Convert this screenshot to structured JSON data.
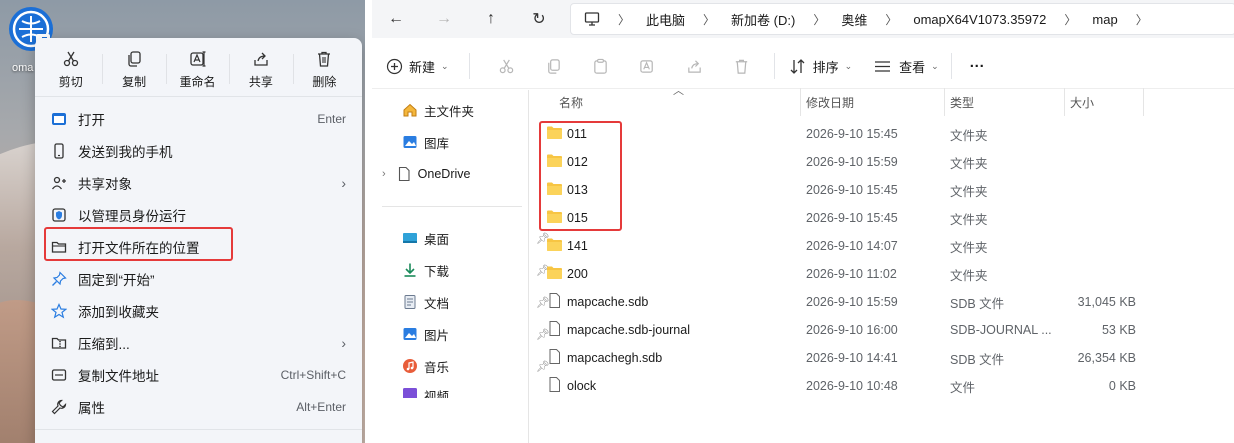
{
  "desktop": {
    "icon_label": "oma",
    "colors": {
      "icon_blue": "#1b6fd6",
      "highlight_red": "#e53a3a"
    }
  },
  "context_menu": {
    "toolbar": [
      {
        "label": "剪切",
        "icon": "scissors-icon"
      },
      {
        "label": "复制",
        "icon": "copy-icon"
      },
      {
        "label": "重命名",
        "icon": "rename-icon"
      },
      {
        "label": "共享",
        "icon": "share-icon"
      },
      {
        "label": "删除",
        "icon": "trash-icon"
      }
    ],
    "items": [
      {
        "label": "打开",
        "shortcut": "Enter",
        "icon": "open-app-icon"
      },
      {
        "label": "发送到我的手机",
        "shortcut": "",
        "icon": "phone-icon"
      },
      {
        "label": "共享对象",
        "shortcut": "",
        "icon": "share-target-icon",
        "submenu": true
      },
      {
        "label": "以管理员身份运行",
        "shortcut": "",
        "icon": "shield-icon"
      },
      {
        "label": "打开文件所在的位置",
        "shortcut": "",
        "icon": "folder-open-icon",
        "highlighted": true
      },
      {
        "label": "固定到“开始”",
        "shortcut": "",
        "icon": "pin-icon"
      },
      {
        "label": "添加到收藏夹",
        "shortcut": "",
        "icon": "star-icon"
      },
      {
        "label": "压缩到...",
        "shortcut": "",
        "icon": "zip-icon",
        "submenu": true
      },
      {
        "label": "复制文件地址",
        "shortcut": "Ctrl+Shift+C",
        "icon": "path-copy-icon"
      },
      {
        "label": "属性",
        "shortcut": "Alt+Enter",
        "icon": "wrench-icon"
      }
    ]
  },
  "explorer": {
    "breadcrumb": [
      "此电脑",
      "新加卷 (D:)",
      "奥维",
      "omapX64V1073.35972",
      "map"
    ],
    "commands": {
      "new": "新建",
      "sort": "排序",
      "view": "查看",
      "more": "···"
    },
    "nav": {
      "home": "主文件夹",
      "gallery": "图库",
      "onedrive": "OneDrive",
      "desktop": "桌面",
      "downloads": "下载",
      "documents": "文档",
      "pictures": "图片",
      "music": "音乐",
      "videos": "视频"
    },
    "columns": {
      "name": "名称",
      "date": "修改日期",
      "type": "类型",
      "size": "大小"
    },
    "files": [
      {
        "name": "011",
        "date": "2026-9-10 15:45",
        "type": "文件夹",
        "size": "",
        "kind": "folder"
      },
      {
        "name": "012",
        "date": "2026-9-10 15:59",
        "type": "文件夹",
        "size": "",
        "kind": "folder"
      },
      {
        "name": "013",
        "date": "2026-9-10 15:45",
        "type": "文件夹",
        "size": "",
        "kind": "folder"
      },
      {
        "name": "015",
        "date": "2026-9-10 15:45",
        "type": "文件夹",
        "size": "",
        "kind": "folder"
      },
      {
        "name": "141",
        "date": "2026-9-10 14:07",
        "type": "文件夹",
        "size": "",
        "kind": "folder"
      },
      {
        "name": "200",
        "date": "2026-9-10 11:02",
        "type": "文件夹",
        "size": "",
        "kind": "folder"
      },
      {
        "name": "mapcache.sdb",
        "date": "2026-9-10 15:59",
        "type": "SDB 文件",
        "size": "31,045 KB",
        "kind": "file"
      },
      {
        "name": "mapcache.sdb-journal",
        "date": "2026-9-10 16:00",
        "type": "SDB-JOURNAL ...",
        "size": "53 KB",
        "kind": "file"
      },
      {
        "name": "mapcachegh.sdb",
        "date": "2026-9-10 14:41",
        "type": "SDB 文件",
        "size": "26,354 KB",
        "kind": "file"
      },
      {
        "name": "olock",
        "date": "2026-9-10 10:48",
        "type": "文件",
        "size": "0 KB",
        "kind": "file"
      }
    ]
  }
}
